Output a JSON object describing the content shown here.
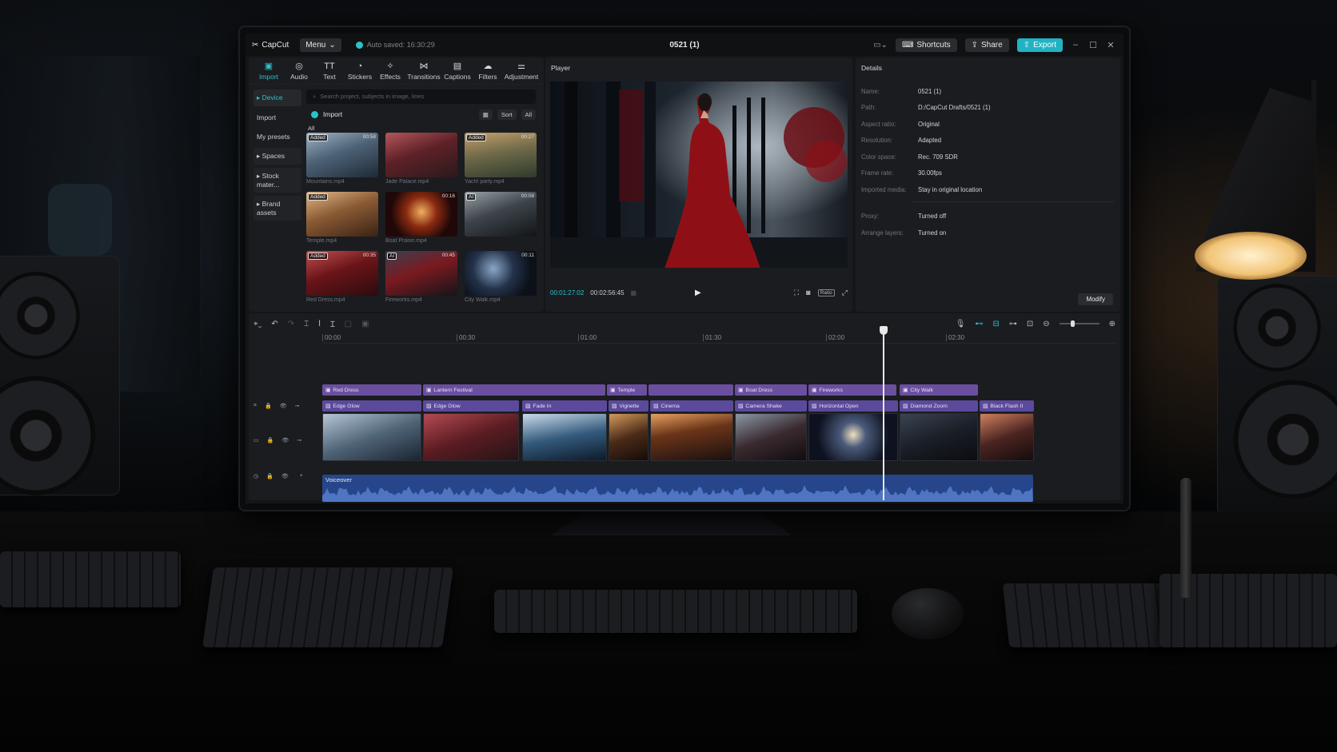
{
  "app": {
    "name": "CapCut",
    "menu_label": "Menu",
    "auto_saved": "Auto saved: 16:30:29",
    "project_title": "0521 (1)",
    "shortcuts_label": "Shortcuts",
    "share_label": "Share",
    "export_label": "Export"
  },
  "toolbar": [
    {
      "label": "Import",
      "icon": "import-icon",
      "glyph": "▣"
    },
    {
      "label": "Audio",
      "icon": "audio-icon",
      "glyph": "◎"
    },
    {
      "label": "Text",
      "icon": "text-icon",
      "glyph": "TT"
    },
    {
      "label": "Stickers",
      "icon": "stickers-icon",
      "glyph": "◔"
    },
    {
      "label": "Effects",
      "icon": "effects-icon",
      "glyph": "✧"
    },
    {
      "label": "Transitions",
      "icon": "transitions-icon",
      "glyph": "⋈"
    },
    {
      "label": "Captions",
      "icon": "captions-icon",
      "glyph": "▤"
    },
    {
      "label": "Filters",
      "icon": "filters-icon",
      "glyph": "☁"
    },
    {
      "label": "Adjustment",
      "icon": "adjustment-icon",
      "glyph": "⚌"
    }
  ],
  "sidebar": [
    {
      "label": "▸ Device"
    },
    {
      "label": "Import"
    },
    {
      "label": "My presets"
    },
    {
      "label": "▸ Spaces"
    },
    {
      "label": "▸ Stock mater..."
    },
    {
      "label": "▸ Brand assets"
    }
  ],
  "media": {
    "search_placeholder": "Search project, subjects in image, lines",
    "import_label": "Import",
    "view_label": "▦",
    "sort_label": "Sort",
    "filter_label": "All",
    "all_tag": "All",
    "items": [
      {
        "name": "Mountains.mp4",
        "badge": "Added",
        "duration": "00:58",
        "bg": "linear-gradient(160deg,#9fb4c6,#4d6276 45%,#1e2a36)"
      },
      {
        "name": "Jade Palace.mp4",
        "badge": "",
        "duration": "",
        "bg": "linear-gradient(160deg,#b4565c,#5e2127 45%,#2a1a1c)"
      },
      {
        "name": "Yacht party.mp4",
        "badge": "Added",
        "duration": "00:27",
        "bg": "linear-gradient(170deg,#c6a06a,#6f6a4a 45%,#2f3a2c)"
      },
      {
        "name": "Temple.mp4",
        "badge": "Added",
        "duration": "",
        "bg": "linear-gradient(160deg,#e1b888,#8a5a34 45%,#3a2214)"
      },
      {
        "name": "Boat Praise.mp4",
        "badge": "",
        "duration": "00:16",
        "bg": "radial-gradient(circle at 50% 45%,#f0b060,#8a2a10 35%,#200808 70%)"
      },
      {
        "name": "",
        "badge": "AI",
        "duration": "00:08",
        "bg": "linear-gradient(160deg,#9aa2aa,#3d444b 45%,#121416)"
      },
      {
        "name": "Red Dress.mp4",
        "badge": "Added",
        "duration": "00:35",
        "bg": "linear-gradient(160deg,#c05050,#6a1418 45%,#2a0c0e)"
      },
      {
        "name": "Fireworks.mp4",
        "badge": "AI",
        "duration": "00:45",
        "bg": "linear-gradient(160deg,#3a4050,#7a1a20 45%,#151418)"
      },
      {
        "name": "City Walk.mp4",
        "badge": "",
        "duration": "00:11",
        "bg": "radial-gradient(circle at 40% 40%,#8aa6c8,#23324a 40%,#0c1018 75%)"
      }
    ]
  },
  "player": {
    "header": "Player",
    "current_time": "00:01:27:02",
    "total_time": "00:02:56:45",
    "ratio_label": "Ratio"
  },
  "details": {
    "header": "Details",
    "rows": [
      {
        "key": "Name:",
        "value": "0521 (1)"
      },
      {
        "key": "Path:",
        "value": "D:/CapCut Drafts/0521 (1)"
      },
      {
        "key": "Aspect ratio:",
        "value": "Original"
      },
      {
        "key": "Resolution:",
        "value": "Adapted"
      },
      {
        "key": "Color space:",
        "value": "Rec. 709 SDR"
      },
      {
        "key": "Frame rate:",
        "value": "30.00fps"
      },
      {
        "key": "Imported media:",
        "value": "Stay in original location"
      }
    ],
    "rows2": [
      {
        "key": "Proxy:",
        "value": "Turned off"
      },
      {
        "key": "Arrange layers:",
        "value": "Turned on"
      }
    ],
    "modify_label": "Modify"
  },
  "timeline": {
    "ruler": [
      "00:00",
      "00:30",
      "01:00",
      "01:30",
      "02:00",
      "02:30"
    ],
    "text_clips": [
      "Red Dress",
      "Lantern Festival",
      "Temple",
      "",
      "Boat Dress",
      "Fireworks",
      "City Walk"
    ],
    "effect_clips": [
      "Edge Glow",
      "Edge Glow",
      "Fade In",
      "Vignette",
      "Cinema",
      "Camera Shake",
      "Horizontal Open",
      "Diamond Zoom",
      "Black Flash II"
    ],
    "audio_label": "Voiceover"
  },
  "colors": {
    "accent": "#2bc2c8",
    "text_clip": "#6a4fa0",
    "audio_track": "#27458a"
  }
}
